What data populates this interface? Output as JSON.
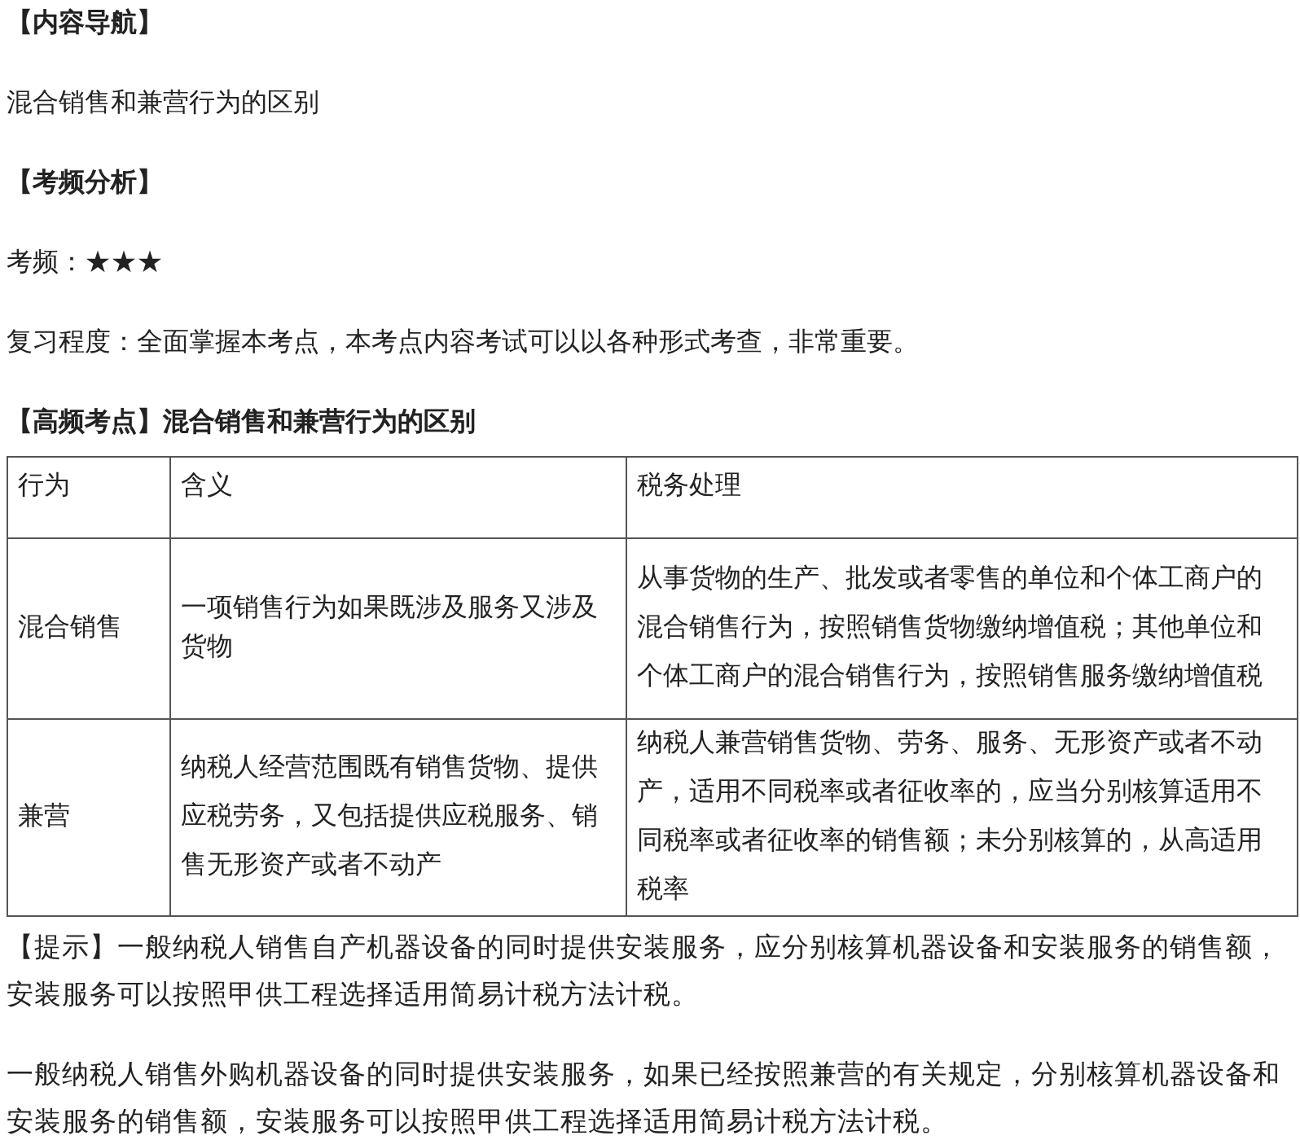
{
  "sections": [
    {
      "kind": "heading",
      "text": "【内容导航】"
    },
    {
      "kind": "paragraph",
      "text": "混合销售和兼营行为的区别"
    },
    {
      "kind": "heading",
      "text": "【考频分析】"
    },
    {
      "kind": "paragraph",
      "text": "考频：★★★"
    },
    {
      "kind": "paragraph",
      "text": "复习程度：全面掌握本考点，本考点内容考试可以以各种形式考查，非常重要。"
    },
    {
      "kind": "heading",
      "text": "【高频考点】混合销售和兼营行为的区别"
    }
  ],
  "table": {
    "columns": [
      "行为",
      "含义",
      "税务处理"
    ],
    "rows": [
      [
        "混合销售",
        "一项销售行为如果既涉及服务又涉及货物",
        "从事货物的生产、批发或者零售的单位和个体工商户的混合销售行为，按照销售货物缴纳增值税；其他单位和个体工商户的混合销售行为，按照销售服务缴纳增值税"
      ],
      [
        "兼营",
        "纳税人经营范围既有销售货物、提供应税劳务，又包括提供应税服务、销售无形资产或者不动产",
        "纳税人兼营销售货物、劳务、服务、无形资产或者不动产，适用不同税率或者征收率的，应当分别核算适用不同税率或者征收率的销售额；未分别核算的，从高适用税率"
      ]
    ]
  },
  "notes": [
    "【提示】一般纳税人销售自产机器设备的同时提供安装服务，应分别核算机器设备和安装服务的销售额，安装服务可以按照甲供工程选择适用简易计税方法计税。",
    "一般纳税人销售外购机器设备的同时提供安装服务，如果已经按照兼营的有关规定，分别核算机器设备和安装服务的销售额，安装服务可以按照甲供工程选择适用简易计税方法计税。"
  ]
}
